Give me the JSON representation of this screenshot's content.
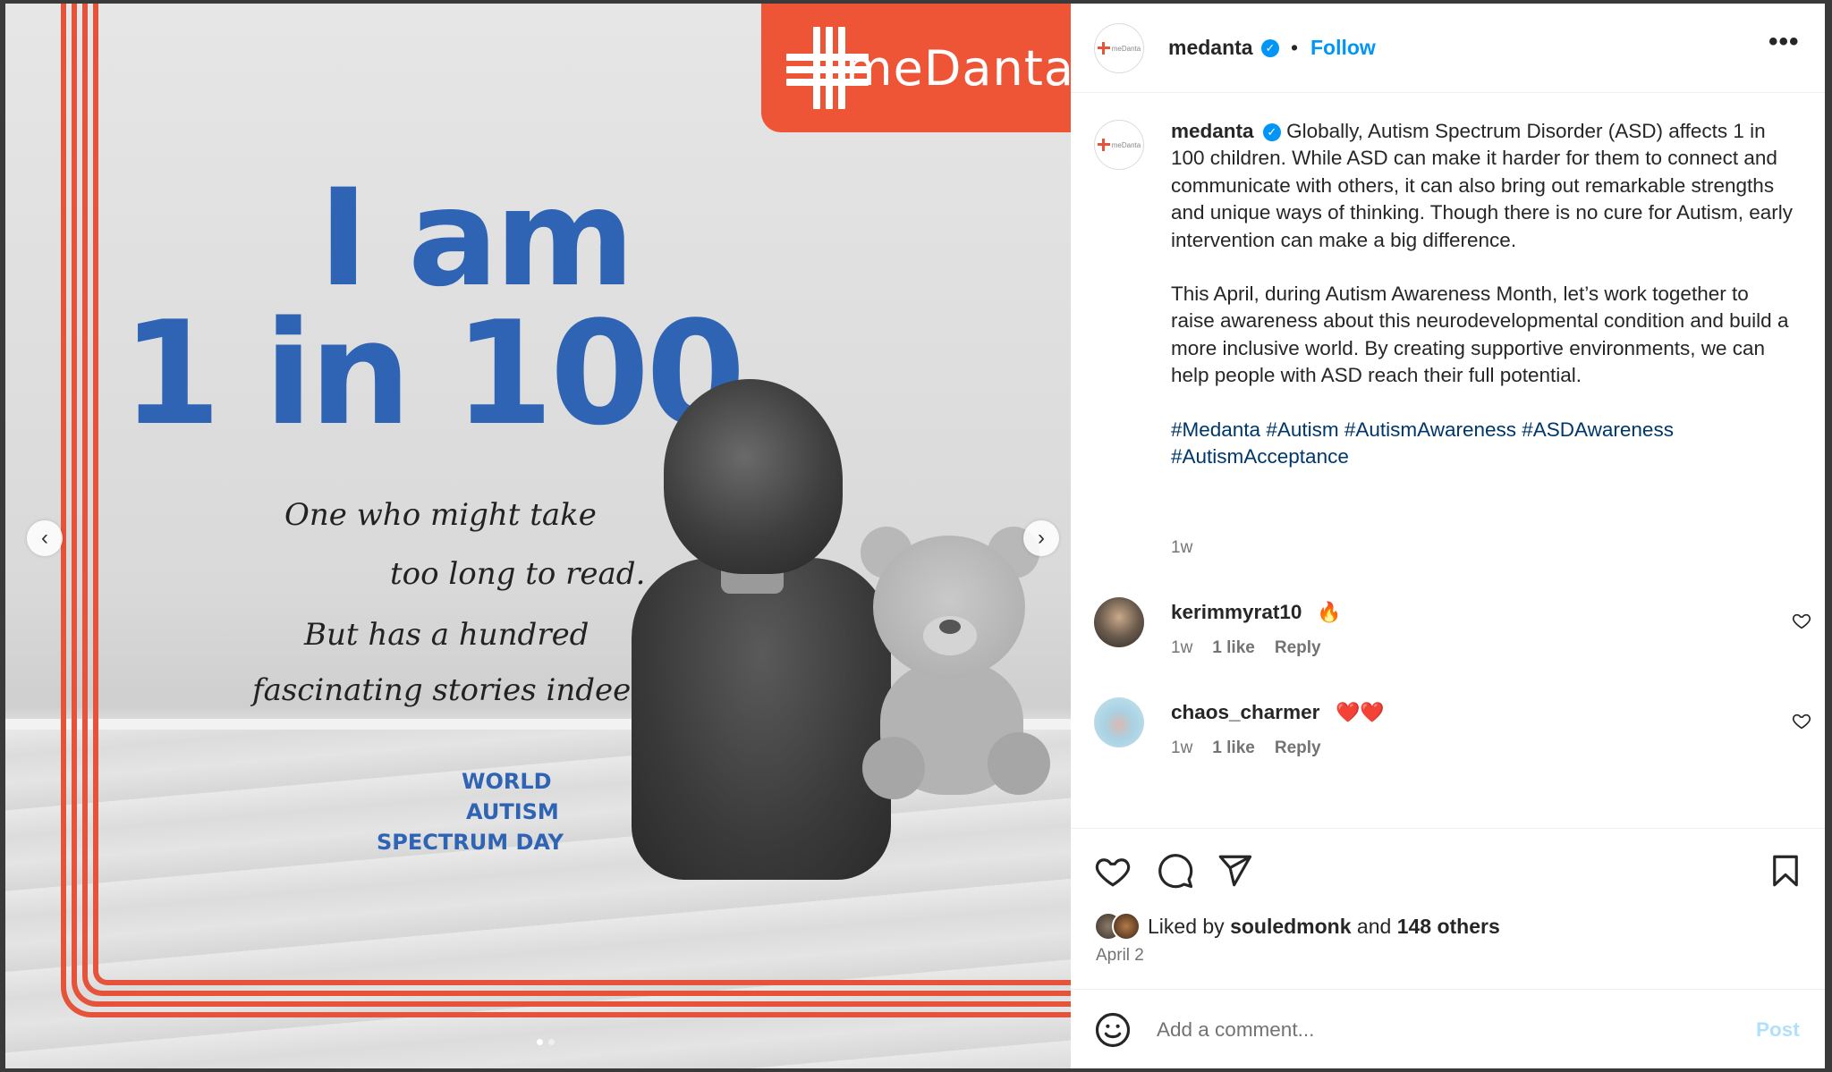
{
  "post": {
    "image": {
      "brand_name": "meDanta",
      "headline_line1": "I am",
      "headline_line2": "1 in 100",
      "poem": [
        "One who might take",
        "too long to read.",
        "But has a hundred",
        "fascinating stories indeed."
      ],
      "day_lines": [
        "WORLD",
        "AUTISM",
        "SPECTRUM DAY"
      ],
      "slide_count": 2,
      "active_slide": 1,
      "colors": {
        "brand_orange": "#ee5436",
        "headline_blue": "#2e64b3"
      }
    },
    "header": {
      "username": "medanta",
      "separator": "•",
      "follow_label": "Follow",
      "more_label": "•••",
      "verified_icon": "verified-badge-icon"
    },
    "caption": {
      "username": "medanta",
      "paragraph1": "Globally, Autism Spectrum Disorder (ASD) affects 1 in 100 children. While ASD can make it harder for them to connect and communicate with others, it can also bring out remarkable strengths and unique ways of thinking. Though there is no cure for Autism, early intervention can make a big difference.",
      "paragraph2": "This April, during Autism Awareness Month, let’s work together to raise awareness about this neurodevelopmental condition and build a more inclusive world. By creating supportive environments, we can help people with ASD reach their full potential.",
      "hashtags": "#Medanta #Autism #AutismAwareness #ASDAwareness #AutismAcceptance",
      "time": "1w"
    },
    "comments": [
      {
        "username": "kerimmyrat10",
        "emoji": "🔥",
        "time": "1w",
        "likes": "1 like",
        "reply_label": "Reply"
      },
      {
        "username": "chaos_charmer",
        "emoji": "❤️❤️",
        "time": "1w",
        "likes": "1 like",
        "reply_label": "Reply"
      }
    ],
    "likes": {
      "prefix": "Liked by ",
      "user": "souledmonk",
      "middle": " and ",
      "others": "148 others"
    },
    "date": "April 2",
    "add_comment": {
      "placeholder": "Add a comment...",
      "post_label": "Post"
    },
    "nav": {
      "prev": "‹",
      "next": "›"
    }
  }
}
